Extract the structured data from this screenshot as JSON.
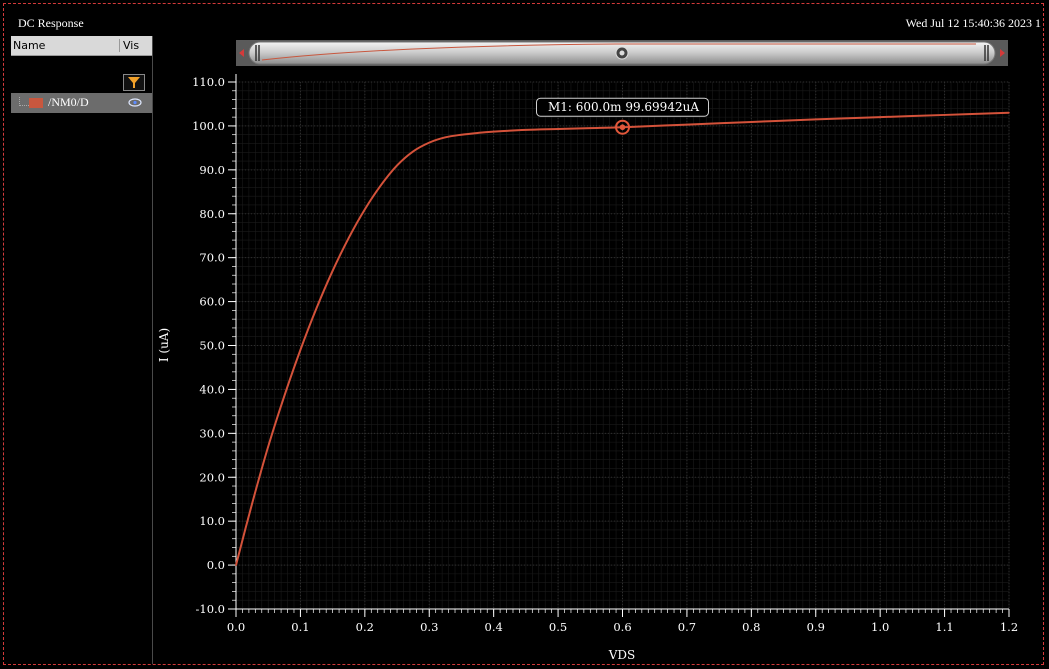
{
  "window": {
    "title": "DC Response",
    "timestamp": "Wed Jul 12 15:40:36 2023  1"
  },
  "sidebar": {
    "columns": [
      "Name",
      "Vis"
    ],
    "signals": [
      {
        "name": "/NM0/D",
        "color": "#c8573e",
        "visible": true
      }
    ],
    "icons": [
      "filter-icon",
      "eye-icon"
    ]
  },
  "marker": {
    "label": "M1: 600.0m 99.69942uA",
    "x": 0.6,
    "y": 99.69942
  },
  "colors": {
    "background": "#000000",
    "trace": "#d4523a",
    "grid": "#2f2f2f",
    "frame": "#d43a3a"
  },
  "chart_data": {
    "type": "line",
    "xlabel": "VDS",
    "ylabel": "I (uA)",
    "xlim": [
      0.0,
      1.2
    ],
    "ylim": [
      -10.0,
      110.0
    ],
    "xticks": [
      "0.0",
      "0.1",
      "0.2",
      "0.3",
      "0.4",
      "0.5",
      "0.6",
      "0.7",
      "0.8",
      "0.9",
      "1.0",
      "1.1",
      "1.2"
    ],
    "yticks": [
      "-10.0",
      "0.0",
      "10.0",
      "20.0",
      "30.0",
      "40.0",
      "50.0",
      "60.0",
      "70.0",
      "80.0",
      "90.0",
      "100.0",
      "110.0"
    ],
    "grid": true,
    "series": [
      {
        "name": "/NM0/D",
        "x": [
          0.0,
          0.025,
          0.05,
          0.075,
          0.1,
          0.125,
          0.15,
          0.175,
          0.2,
          0.225,
          0.25,
          0.275,
          0.3,
          0.325,
          0.35,
          0.375,
          0.4,
          0.45,
          0.5,
          0.55,
          0.6,
          0.7,
          0.8,
          0.9,
          1.0,
          1.1,
          1.2
        ],
        "y": [
          0.0,
          14.0,
          27.0,
          38.5,
          49.0,
          58.5,
          67.0,
          74.5,
          81.0,
          86.5,
          91.0,
          94.2,
          96.2,
          97.4,
          98.0,
          98.4,
          98.7,
          99.1,
          99.3,
          99.5,
          99.69942,
          100.3,
          100.9,
          101.5,
          102.0,
          102.5,
          103.0
        ]
      }
    ]
  }
}
